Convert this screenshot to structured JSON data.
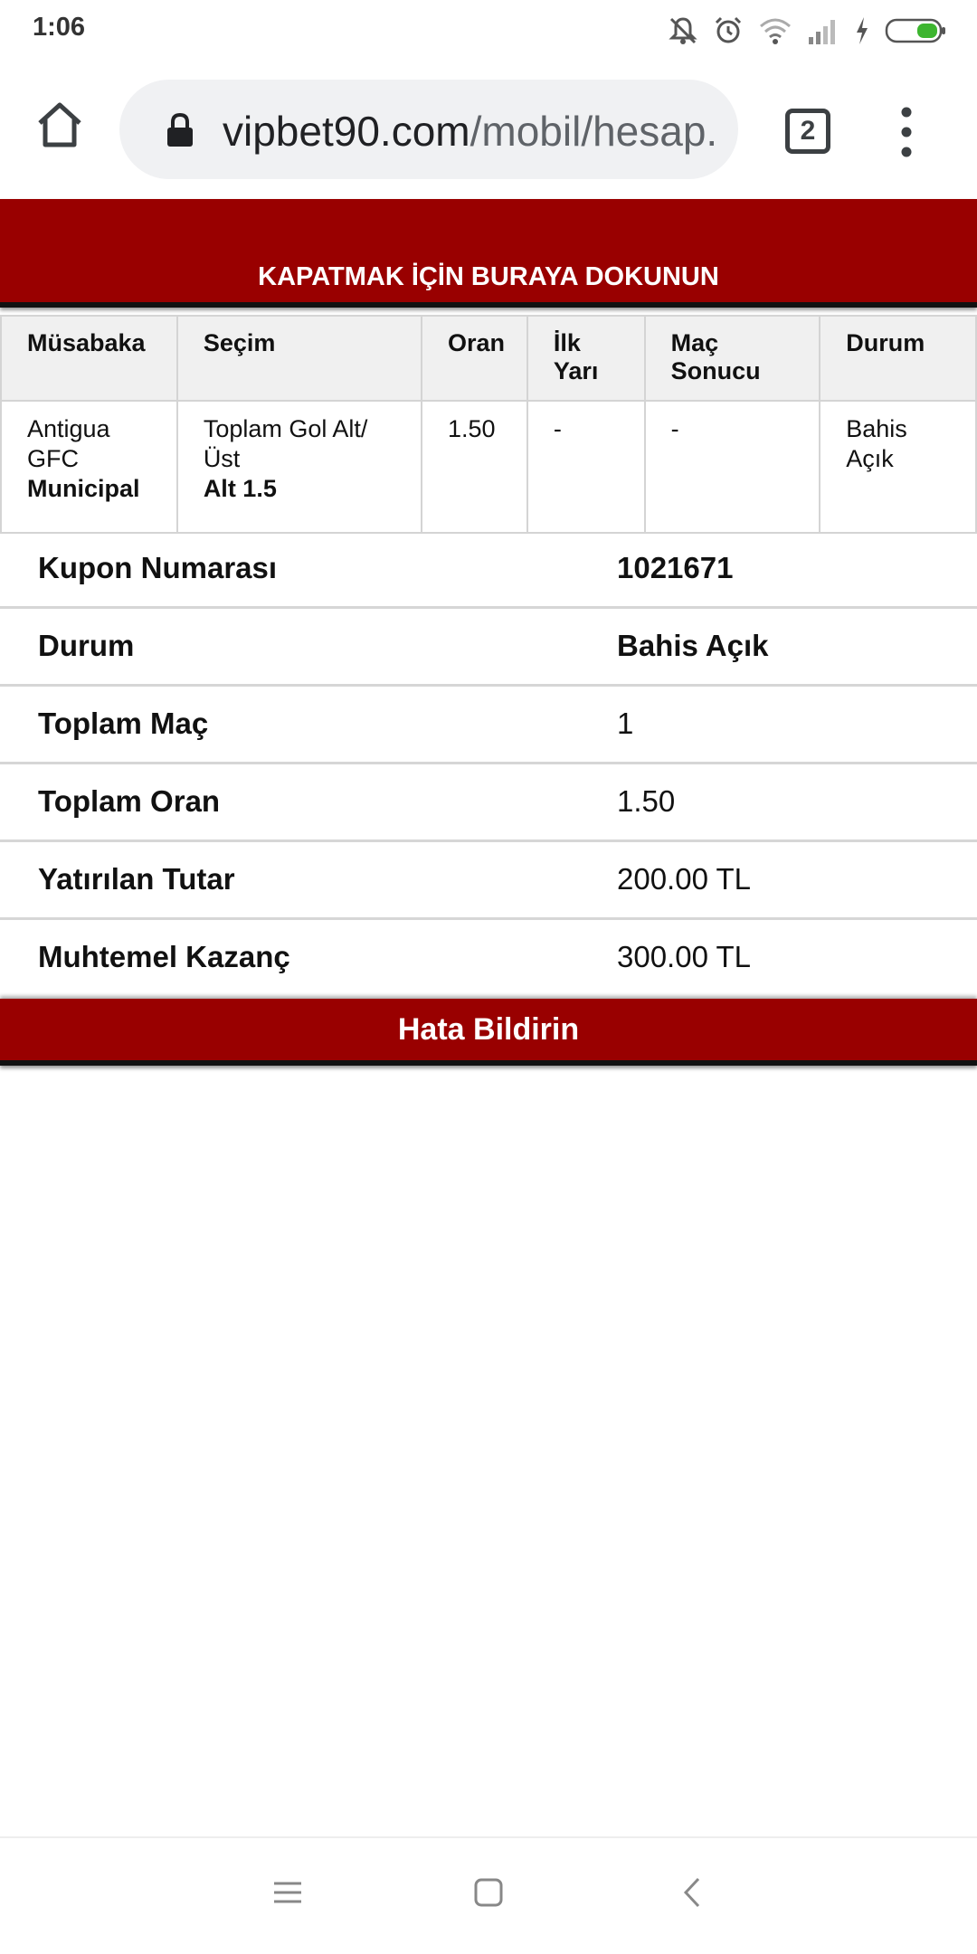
{
  "status_bar": {
    "time": "1:06",
    "icons": [
      "mute-icon",
      "alarm-icon",
      "wifi-icon",
      "signal-icon",
      "charging-icon",
      "battery-icon"
    ],
    "battery_color": "#3db52f"
  },
  "browser": {
    "url_domain": "vipbet90.com",
    "url_path": "/mobil/hesap.",
    "tab_count": "2"
  },
  "page": {
    "close_banner": "KAPATMAK İÇİN BURAYA DOKUNUN",
    "table": {
      "headers": {
        "match": "Müsabaka",
        "selection": "Seçim",
        "odds": "Oran",
        "first_half_1": "İlk",
        "first_half_2": "Yarı",
        "result_1": "Maç",
        "result_2": "Sonucu",
        "status": "Durum"
      },
      "rows": [
        {
          "team1_a": "Antigua",
          "team1_b": "GFC",
          "team2": "Municipal",
          "market_1": "Toplam Gol Alt/",
          "market_2": "Üst",
          "pick": "Alt 1.5",
          "odds": "1.50",
          "first_half": "-",
          "result": "-",
          "status_1": "Bahis",
          "status_2": "Açık"
        }
      ]
    },
    "summary": [
      {
        "label": "Kupon Numarası",
        "value": "1021671"
      },
      {
        "label": "Durum",
        "value": "Bahis Açık"
      },
      {
        "label": "Toplam Maç",
        "value": "1"
      },
      {
        "label": "Toplam Oran",
        "value": "1.50"
      },
      {
        "label": "Yatırılan Tutar",
        "value": "200.00 TL"
      },
      {
        "label": "Muhtemel Kazanç",
        "value": "300.00 TL"
      }
    ],
    "report_button": "Hata Bildirin",
    "accent_color": "#990000"
  },
  "nav_bar": {
    "icons": [
      "recents-icon",
      "home-icon",
      "back-icon"
    ]
  }
}
